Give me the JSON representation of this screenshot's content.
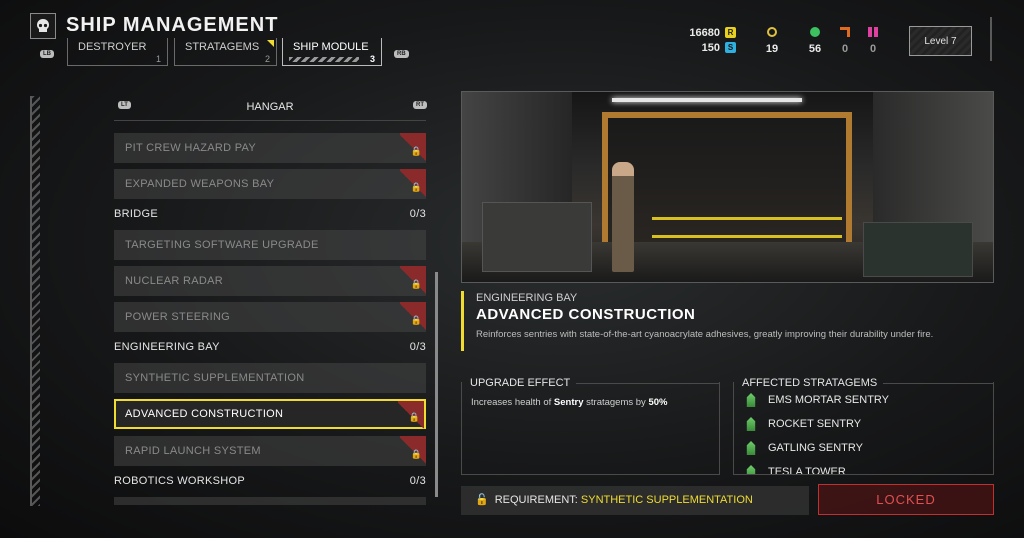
{
  "header": {
    "title": "SHIP MANAGEMENT",
    "hint_left": "LB",
    "hint_right": "RB",
    "tabs": [
      {
        "label": "DESTROYER",
        "num": "1"
      },
      {
        "label": "STRATAGEMS",
        "num": "2"
      },
      {
        "label": "SHIP MODULE",
        "num": "3"
      }
    ]
  },
  "resources": {
    "req_value": "16680",
    "req_icon": "R",
    "samples_value": "150",
    "samples_icon": "S",
    "medals": "19",
    "green": "56",
    "orange": "0",
    "pink": "0",
    "level": "Level 7"
  },
  "list": {
    "hint_left": "LT",
    "hint_right": "RT",
    "header": "HANGAR",
    "items": [
      {
        "label": "PIT CREW HAZARD PAY"
      },
      {
        "label": "EXPANDED WEAPONS BAY"
      },
      {
        "label": "TARGETING SOFTWARE UPGRADE"
      },
      {
        "label": "NUCLEAR RADAR"
      },
      {
        "label": "POWER STEERING"
      },
      {
        "label": "SYNTHETIC SUPPLEMENTATION"
      },
      {
        "label": "ADVANCED CONSTRUCTION"
      },
      {
        "label": "RAPID LAUNCH SYSTEM"
      }
    ],
    "sections": [
      {
        "label": "BRIDGE",
        "count": "0/3"
      },
      {
        "label": "ENGINEERING BAY",
        "count": "0/3"
      },
      {
        "label": "ROBOTICS WORKSHOP",
        "count": "0/3"
      }
    ]
  },
  "detail": {
    "category": "ENGINEERING BAY",
    "name": "ADVANCED CONSTRUCTION",
    "description": "Reinforces sentries with state-of-the-art cyanoacrylate adhesives, greatly improving their durability under fire.",
    "effect_header": "UPGRADE EFFECT",
    "effect_pre": "Increases health of ",
    "effect_target": "Sentry",
    "effect_mid": " stratagems by ",
    "effect_value": "50%",
    "affected_header": "AFFECTED STRATAGEMS",
    "stratagems": [
      "EMS MORTAR SENTRY",
      "ROCKET SENTRY",
      "GATLING SENTRY",
      "TESLA TOWER"
    ],
    "requirement_label": "REQUIREMENT: ",
    "requirement_value": "SYNTHETIC SUPPLEMENTATION",
    "status": "LOCKED"
  },
  "colors": {
    "accent": "#f0dc30",
    "locked": "#c03030",
    "stratagem": "#6fce6a"
  }
}
